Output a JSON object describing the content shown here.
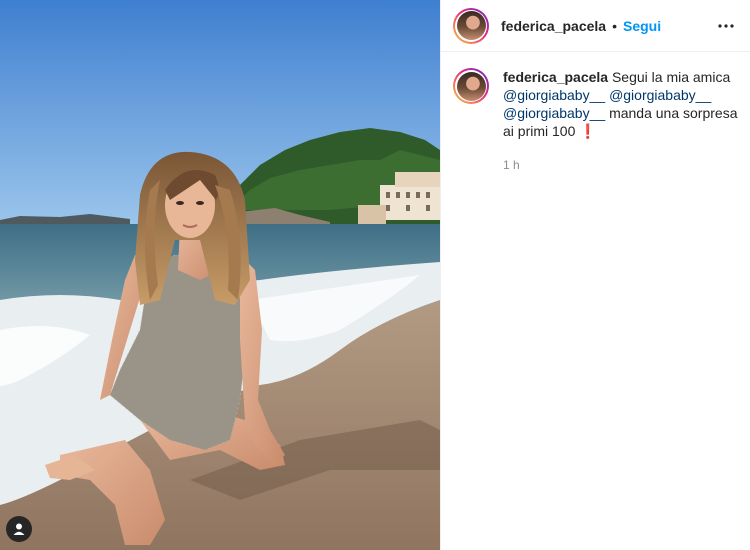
{
  "post": {
    "image_alt": "Photo by federica_pacela",
    "user_tag_icon": "person-icon"
  },
  "header": {
    "username": "federica_pacela",
    "separator": "•",
    "follow_label": "Segui",
    "more_icon": "ellipsis-icon"
  },
  "caption": {
    "username": "federica_pacela",
    "text_1": "Segui la mia amica",
    "mention_1": "@giorgiababy__",
    "mention_2": "@giorgiababy__",
    "mention_3": "@giorgiababy__",
    "text_2": "manda una sorpresa ai primi 100",
    "emoji": "❗",
    "time": "1 h"
  },
  "colors": {
    "accent": "#0095f6",
    "mention": "#00376b",
    "text": "#262626",
    "muted": "#8e8e8e"
  }
}
